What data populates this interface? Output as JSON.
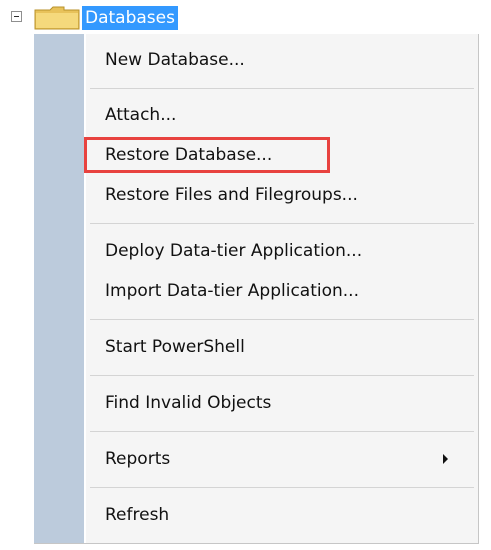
{
  "tree": {
    "node_label": "Databases",
    "expander_icon": "minus-box-icon",
    "folder_icon": "folder-icon"
  },
  "menu": {
    "items": [
      {
        "label": "New Database..."
      },
      {
        "label": "Attach..."
      },
      {
        "label": "Restore Database..."
      },
      {
        "label": "Restore Files and Filegroups..."
      },
      {
        "label": "Deploy Data-tier Application..."
      },
      {
        "label": "Import Data-tier Application..."
      },
      {
        "label": "Start PowerShell"
      },
      {
        "label": "Find Invalid Objects"
      },
      {
        "label": "Reports",
        "has_submenu": true
      },
      {
        "label": "Refresh"
      }
    ],
    "highlighted_item": "Restore Database...",
    "highlight_color": "#e8423f",
    "gutter_color": "#bccbdc",
    "selection_color": "#3399ff"
  }
}
